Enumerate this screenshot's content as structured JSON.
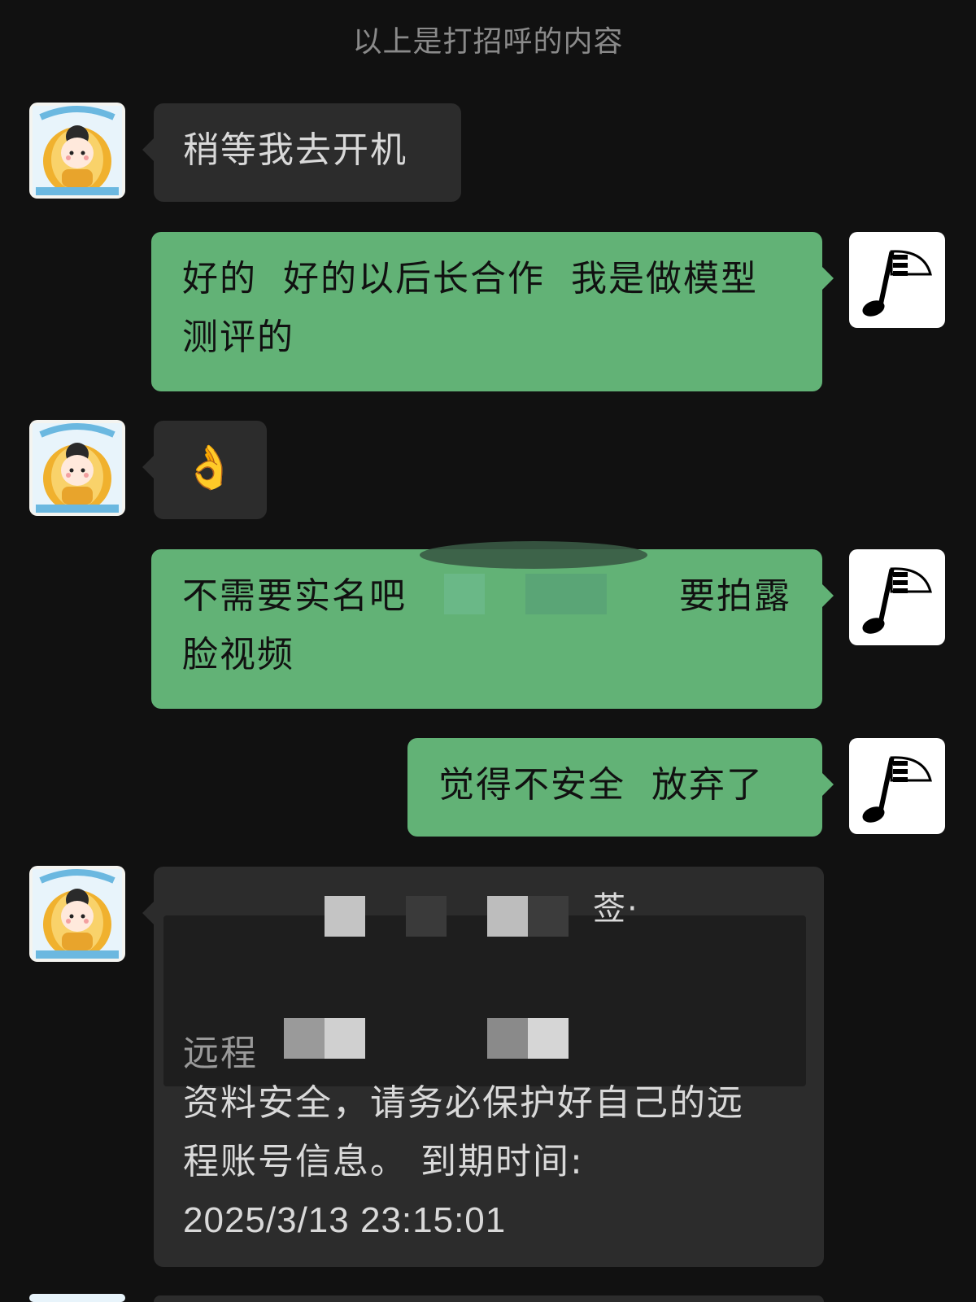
{
  "system_note": "以上是打招呼的内容",
  "messages": [
    {
      "side": "left",
      "text": "稍等我去开机",
      "avatar": "buddha-keep-awake-avatar"
    },
    {
      "side": "right",
      "line1": "好的  好的以后长合作  我是做模型",
      "line2": "测评的",
      "avatar": "music-note-avatar"
    },
    {
      "side": "left",
      "text": "👌",
      "avatar": "buddha-keep-awake-avatar"
    },
    {
      "side": "right",
      "line1_left": "不需要实名吧",
      "line1_right": "要拍露",
      "line2": "脸视频",
      "avatar": "music-note-avatar"
    },
    {
      "side": "right",
      "text": "觉得不安全  放弃了",
      "avatar": "music-note-avatar"
    },
    {
      "side": "left",
      "partial_line1": "莶·",
      "partial_line3": "远程",
      "line4": "资料安全，请务必保护好自己的远",
      "line5": "程账号信息。 到期时间:",
      "line6": "2025/3/13 23:15:01",
      "avatar": "buddha-keep-awake-avatar"
    }
  ],
  "colors": {
    "background": "#111111",
    "incoming_bubble": "#2c2c2c",
    "outgoing_bubble": "#62b276",
    "system_text": "#8a8a8a"
  }
}
